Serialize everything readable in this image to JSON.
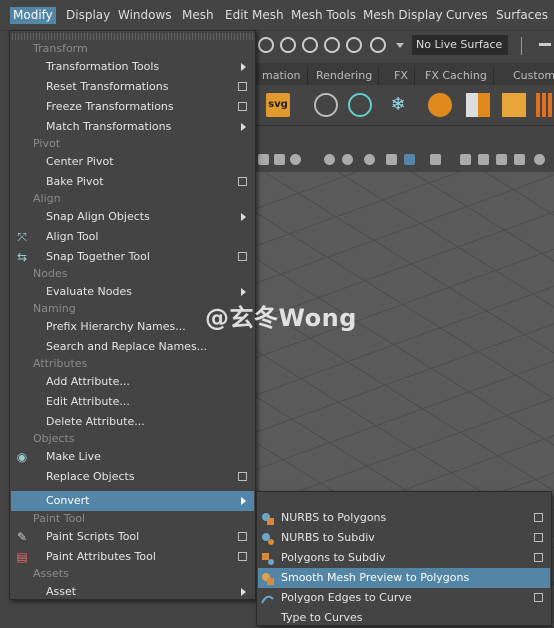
{
  "menubar": {
    "items": [
      "Modify",
      "Display",
      "Windows",
      "Mesh",
      "Edit Mesh",
      "Mesh Tools",
      "Mesh Display",
      "Curves",
      "Surfaces"
    ],
    "active": "Modify"
  },
  "toolbar": {
    "live_surface": "No Live Surface",
    "shelf_tabs": [
      "mation",
      "Rendering",
      "FX",
      "FX Caching",
      "Custom"
    ]
  },
  "modify_menu": {
    "transform": {
      "header": "Transform",
      "items": [
        "Transformation Tools",
        "Reset Transformations",
        "Freeze Transformations",
        "Match Transformations"
      ]
    },
    "pivot": {
      "header": "Pivot",
      "items": [
        "Center Pivot",
        "Bake Pivot"
      ]
    },
    "align": {
      "header": "Align",
      "items": [
        "Snap Align Objects",
        "Align Tool",
        "Snap Together Tool"
      ]
    },
    "nodes": {
      "header": "Nodes",
      "items": [
        "Evaluate Nodes"
      ]
    },
    "naming": {
      "header": "Naming",
      "items": [
        "Prefix Hierarchy Names...",
        "Search and Replace Names..."
      ]
    },
    "attributes": {
      "header": "Attributes",
      "items": [
        "Add Attribute...",
        "Edit Attribute...",
        "Delete Attribute..."
      ]
    },
    "objects": {
      "header": "Objects",
      "items": [
        "Make Live",
        "Replace Objects",
        "Convert"
      ]
    },
    "paint_tool": {
      "header": "Paint Tool",
      "items": [
        "Paint Scripts Tool",
        "Paint Attributes Tool"
      ]
    },
    "assets": {
      "header": "Assets",
      "items": [
        "Asset"
      ]
    }
  },
  "convert_menu": {
    "items": [
      "NURBS to Polygons",
      "NURBS to Subdiv",
      "Polygons to Subdiv",
      "Smooth Mesh Preview to Polygons",
      "Polygon Edges to Curve",
      "Type to Curves"
    ],
    "highlighted": "Smooth Mesh Preview to Polygons"
  },
  "watermark": "@玄冬Wong",
  "colors": {
    "highlight": "#5285a6",
    "menu_bg": "#444444",
    "section": "#8a8a8a"
  }
}
